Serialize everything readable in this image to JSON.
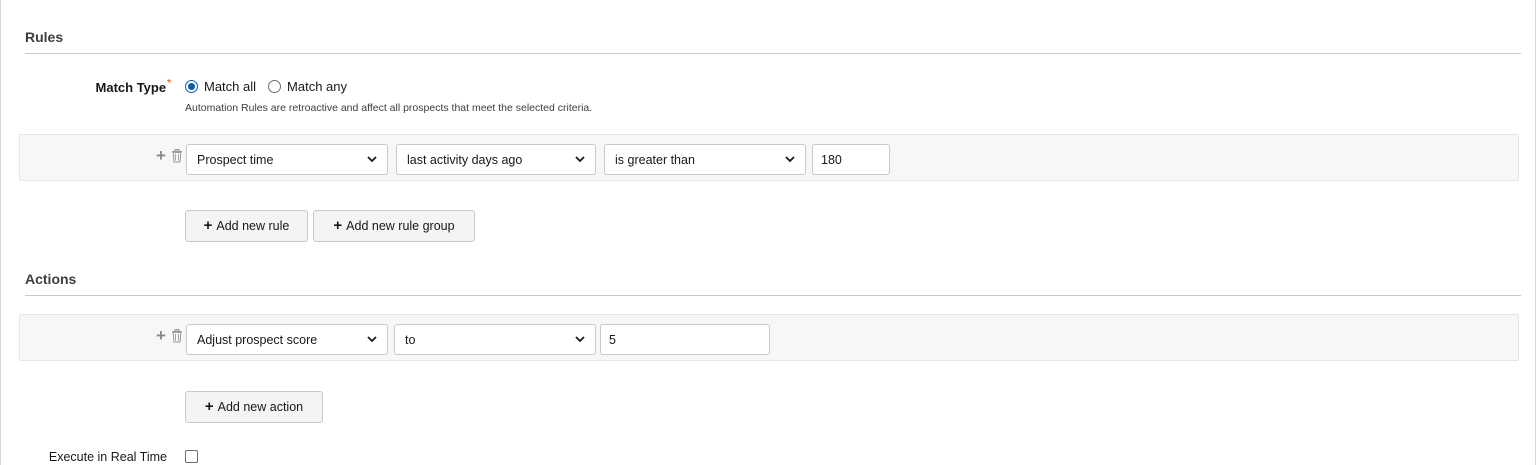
{
  "rules": {
    "title": "Rules",
    "match_type": {
      "label": "Match Type",
      "required_mark": "*",
      "options": [
        {
          "label": "Match all",
          "checked": true
        },
        {
          "label": "Match any",
          "checked": false
        }
      ],
      "help": "Automation Rules are retroactive and affect all prospects that meet the selected criteria."
    },
    "rule_row": {
      "field": "Prospect time",
      "attribute": "last activity days ago",
      "operator": "is greater than",
      "value": "180"
    },
    "add_rule_label": "Add new rule",
    "add_rule_group_label": "Add new rule group"
  },
  "actions": {
    "title": "Actions",
    "action_row": {
      "action": "Adjust prospect score",
      "mode": "to",
      "value": "5"
    },
    "add_action_label": "Add new action"
  },
  "realtime": {
    "label": "Execute in Real Time",
    "checked": false
  },
  "icons": {
    "add": "plus-icon",
    "delete": "trash-icon",
    "dropdown": "chevron-down-icon"
  },
  "colors": {
    "accent": "#0b5cab",
    "required": "#e8732a",
    "row_bg": "#f7f7f7",
    "border": "#c9c9c9"
  }
}
